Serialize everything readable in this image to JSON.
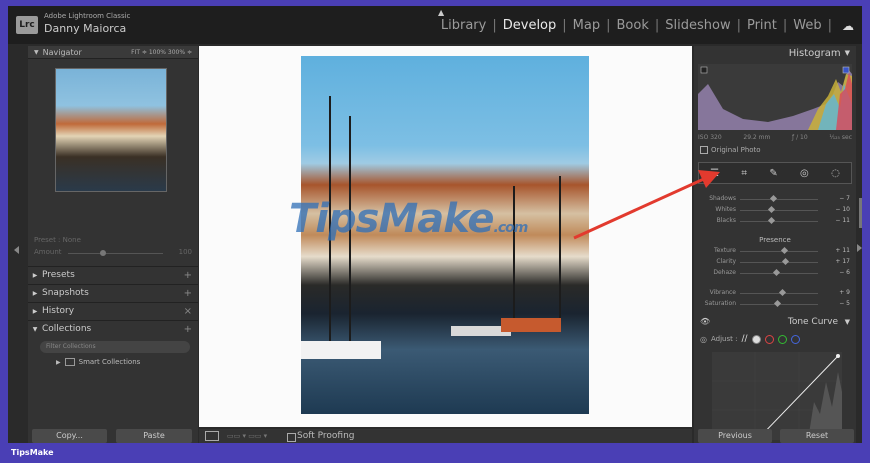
{
  "titlebar": {
    "logo": "Lrc",
    "app_name": "Adobe Lightroom Classic",
    "user_name": "Danny Maiorca",
    "modules": [
      "Library",
      "Develop",
      "Map",
      "Book",
      "Slideshow",
      "Print",
      "Web"
    ],
    "active_module": "Develop",
    "cloud_icon": "cloud-icon"
  },
  "left_panel": {
    "navigator": {
      "label": "Navigator",
      "options": "FIT ≑  100%  300% ≑"
    },
    "preset_label": "Preset : None",
    "amount_label": "Amount",
    "amount_value": "100",
    "sections": [
      {
        "label": "Presets",
        "action": "+"
      },
      {
        "label": "Snapshots",
        "action": "+"
      },
      {
        "label": "History",
        "action": "×"
      },
      {
        "label": "Collections",
        "action": "+"
      }
    ],
    "collections_search_placeholder": "Filter Collections",
    "smart_collections": "Smart Collections",
    "copy_button": "Copy...",
    "paste_button": "Paste"
  },
  "center": {
    "watermark": "TipsMake",
    "watermark_domain": ".com",
    "toolbar": {
      "soft_proofing": "Soft Proofing"
    }
  },
  "right_panel": {
    "histogram": {
      "label": "Histogram",
      "iso": "ISO 320",
      "focal": "29.2 mm",
      "aperture": "ƒ / 10",
      "shutter": "¹⁄₁₂₅ sec",
      "original_photo": "Original Photo"
    },
    "basic_sliders": [
      {
        "label": "Shadows",
        "value": "− 7",
        "pos": 0.42
      },
      {
        "label": "Whites",
        "value": "− 10",
        "pos": 0.4
      },
      {
        "label": "Blacks",
        "value": "− 11",
        "pos": 0.4
      }
    ],
    "presence_label": "Presence",
    "presence_sliders": [
      {
        "label": "Texture",
        "value": "+ 11",
        "pos": 0.56
      },
      {
        "label": "Clarity",
        "value": "+ 17",
        "pos": 0.58
      },
      {
        "label": "Dehaze",
        "value": "− 6",
        "pos": 0.46
      }
    ],
    "color_sliders": [
      {
        "label": "Vibrance",
        "value": "+ 9",
        "pos": 0.54
      },
      {
        "label": "Saturation",
        "value": "− 5",
        "pos": 0.47
      }
    ],
    "tone_curve": {
      "label": "Tone Curve",
      "adjust_label": "Adjust :"
    },
    "previous_button": "Previous",
    "reset_button": "Reset"
  },
  "footer": {
    "brand": "TipsMake"
  },
  "colors": {
    "accent_red": "#e23a2e",
    "footer_bg": "#4a3fb5"
  }
}
